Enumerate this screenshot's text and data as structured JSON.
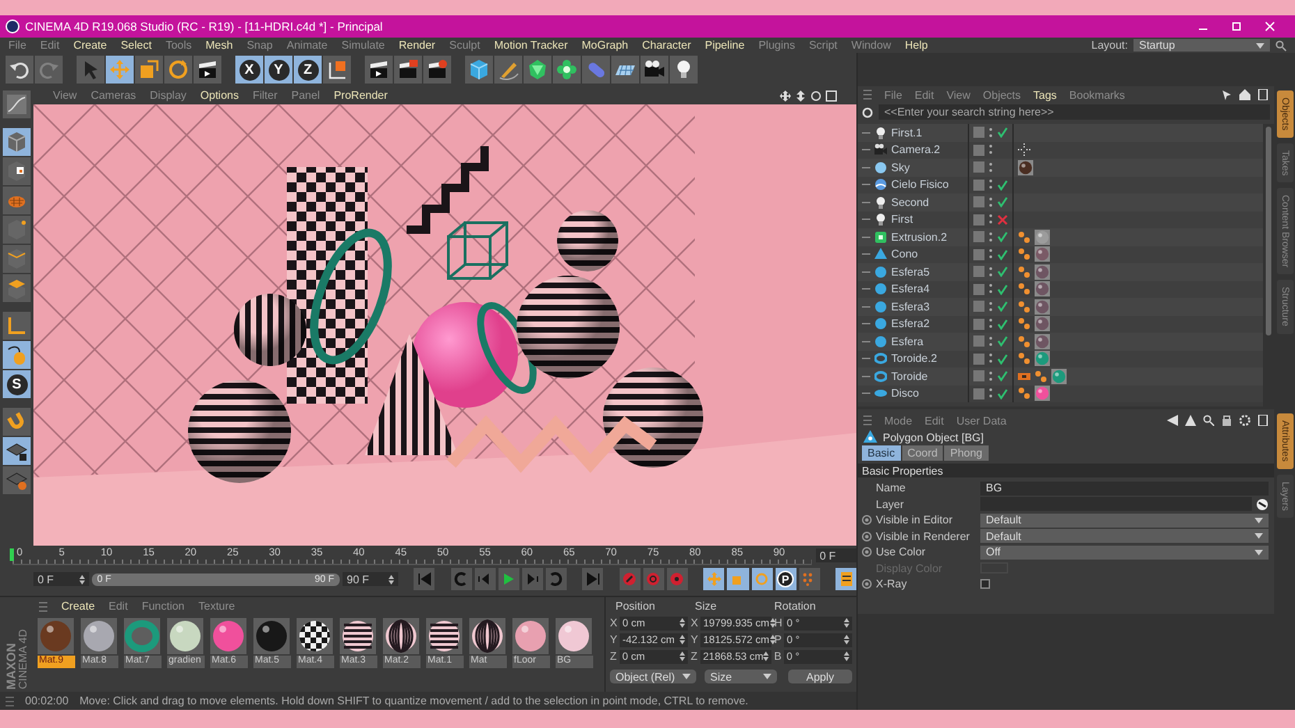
{
  "window": {
    "title": "CINEMA 4D R19.068 Studio (RC - R19) - [11-HDRI.c4d *] - Principal"
  },
  "menu": [
    {
      "label": "File",
      "highlighted": false
    },
    {
      "label": "Edit",
      "highlighted": false
    },
    {
      "label": "Create",
      "highlighted": true
    },
    {
      "label": "Select",
      "highlighted": true
    },
    {
      "label": "Tools",
      "highlighted": false
    },
    {
      "label": "Mesh",
      "highlighted": true
    },
    {
      "label": "Snap",
      "highlighted": false
    },
    {
      "label": "Animate",
      "highlighted": false
    },
    {
      "label": "Simulate",
      "highlighted": false
    },
    {
      "label": "Render",
      "highlighted": true
    },
    {
      "label": "Sculpt",
      "highlighted": false
    },
    {
      "label": "Motion Tracker",
      "highlighted": true
    },
    {
      "label": "MoGraph",
      "highlighted": true
    },
    {
      "label": "Character",
      "highlighted": true
    },
    {
      "label": "Pipeline",
      "highlighted": true
    },
    {
      "label": "Plugins",
      "highlighted": false
    },
    {
      "label": "Script",
      "highlighted": false
    },
    {
      "label": "Window",
      "highlighted": false
    },
    {
      "label": "Help",
      "highlighted": true
    }
  ],
  "layout": {
    "label": "Layout:",
    "value": "Startup"
  },
  "toolbar": [
    {
      "selected": false,
      "disabled": false
    },
    {
      "selected": false,
      "disabled": true
    },
    {
      "selected": false,
      "disabled": false
    },
    {
      "selected": true,
      "disabled": false
    },
    {
      "selected": false,
      "disabled": false
    },
    {
      "selected": false,
      "disabled": false
    },
    {
      "selected": false,
      "disabled": false
    },
    {
      "label": "X",
      "selected": true,
      "disabled": false
    },
    {
      "label": "Y",
      "selected": true,
      "disabled": false
    },
    {
      "label": "Z",
      "selected": true,
      "disabled": false
    },
    {
      "selected": false,
      "disabled": false
    },
    {
      "selected": false,
      "disabled": false
    },
    {
      "selected": false,
      "disabled": false
    },
    {
      "selected": false,
      "disabled": false
    },
    {
      "selected": false,
      "disabled": false
    },
    {
      "selected": false,
      "disabled": false
    },
    {
      "selected": false,
      "disabled": false
    },
    {
      "selected": false,
      "disabled": false
    },
    {
      "selected": false,
      "disabled": false
    },
    {
      "selected": false,
      "disabled": false
    },
    {
      "selected": false,
      "disabled": false
    },
    {
      "selected": false,
      "disabled": false
    }
  ],
  "left_tools": [
    {
      "selected": false
    },
    {
      "selected": true
    },
    {
      "selected": false
    },
    {
      "selected": false
    },
    {
      "selected": false
    },
    {
      "selected": false
    },
    {
      "selected": false
    },
    {
      "selected": false
    },
    {
      "selected": true
    },
    {
      "label": "S",
      "selected": true
    },
    {
      "selected": false
    },
    {
      "selected": true
    },
    {
      "selected": false
    }
  ],
  "viewport": {
    "menu": [
      {
        "label": "View",
        "highlighted": false
      },
      {
        "label": "Cameras",
        "highlighted": false
      },
      {
        "label": "Display",
        "highlighted": false
      },
      {
        "label": "Options",
        "highlighted": true
      },
      {
        "label": "Filter",
        "highlighted": false
      },
      {
        "label": "Panel",
        "highlighted": false
      },
      {
        "label": "ProRender",
        "highlighted": true
      }
    ]
  },
  "objects": {
    "menu": [
      {
        "label": "File",
        "highlighted": false
      },
      {
        "label": "Edit",
        "highlighted": false
      },
      {
        "label": "View",
        "highlighted": false
      },
      {
        "label": "Objects",
        "highlighted": false
      },
      {
        "label": "Tags",
        "highlighted": true
      },
      {
        "label": "Bookmarks",
        "highlighted": false
      }
    ],
    "search": {
      "placeholder": "<<Enter your search string here>>"
    },
    "items": [
      {
        "name": "First.1",
        "kind": "light",
        "enabled": true
      },
      {
        "name": "Camera.2",
        "kind": "camera",
        "tags": [
          {
            "kind": "target"
          }
        ]
      },
      {
        "name": "Sky",
        "kind": "sky",
        "tags": [
          {
            "kind": "material",
            "color": "#4a2e22"
          }
        ]
      },
      {
        "name": "Cielo Fisico",
        "kind": "physical-sky",
        "enabled": true
      },
      {
        "name": "Second",
        "kind": "light",
        "enabled": true
      },
      {
        "name": "First",
        "kind": "light",
        "enabled": false
      },
      {
        "name": "Extrusion.2",
        "kind": "extrude",
        "enabled": true,
        "tags": [
          {
            "kind": "phong"
          },
          {
            "kind": "material",
            "color": "#9c9c9c"
          }
        ]
      },
      {
        "name": "Cono",
        "kind": "cone",
        "enabled": true,
        "tags": [
          {
            "kind": "phong"
          },
          {
            "kind": "material",
            "color": "#7a5a66"
          }
        ]
      },
      {
        "name": "Esfera5",
        "kind": "sphere",
        "enabled": true,
        "tags": [
          {
            "kind": "phong"
          },
          {
            "kind": "material",
            "color": "#6e5562"
          }
        ]
      },
      {
        "name": "Esfera4",
        "kind": "sphere",
        "enabled": true,
        "tags": [
          {
            "kind": "phong"
          },
          {
            "kind": "material",
            "color": "#6e5562"
          }
        ]
      },
      {
        "name": "Esfera3",
        "kind": "sphere",
        "enabled": true,
        "tags": [
          {
            "kind": "phong"
          },
          {
            "kind": "material",
            "color": "#6e5562"
          }
        ]
      },
      {
        "name": "Esfera2",
        "kind": "sphere",
        "enabled": true,
        "tags": [
          {
            "kind": "phong"
          },
          {
            "kind": "material",
            "color": "#6e5562"
          }
        ]
      },
      {
        "name": "Esfera",
        "kind": "sphere",
        "enabled": true,
        "tags": [
          {
            "kind": "phong"
          },
          {
            "kind": "material",
            "color": "#6e5562"
          }
        ]
      },
      {
        "name": "Toroide.2",
        "kind": "torus",
        "enabled": true,
        "tags": [
          {
            "kind": "phong"
          },
          {
            "kind": "material",
            "color": "#1c9a7c"
          }
        ]
      },
      {
        "name": "Toroide",
        "kind": "torus",
        "enabled": true,
        "tags": [
          {
            "kind": "restrict"
          },
          {
            "kind": "phong"
          },
          {
            "kind": "material",
            "color": "#1c9a7c"
          }
        ]
      },
      {
        "name": "Disco",
        "kind": "disc",
        "enabled": true,
        "tags": [
          {
            "kind": "phong"
          },
          {
            "kind": "material",
            "color": "#f0509c"
          }
        ]
      }
    ]
  },
  "side_tabs_top": [
    {
      "label": "Objects",
      "selected": true
    },
    {
      "label": "Takes",
      "selected": false
    },
    {
      "label": "Content Browser",
      "selected": false
    },
    {
      "label": "Structure",
      "selected": false
    }
  ],
  "attributes": {
    "menu": [
      {
        "label": "Mode",
        "highlighted": false
      },
      {
        "label": "Edit",
        "highlighted": false
      },
      {
        "label": "User Data",
        "highlighted": false
      }
    ],
    "title": "Polygon Object [BG]",
    "tabs": [
      {
        "label": "Basic",
        "selected": true
      },
      {
        "label": "Coord",
        "selected": false
      },
      {
        "label": "Phong",
        "selected": false
      }
    ],
    "section": "Basic Properties",
    "fields": [
      {
        "kind": "text",
        "label": "Name",
        "value": "BG"
      },
      {
        "kind": "link",
        "label": "Layer"
      },
      {
        "kind": "dropdown",
        "label": "Visible in Editor",
        "value": "Default"
      },
      {
        "kind": "dropdown",
        "label": "Visible in Renderer",
        "value": "Default"
      },
      {
        "kind": "dropdown",
        "label": "Use Color",
        "value": "Off"
      },
      {
        "kind": "color",
        "label": "Display Color",
        "disabled": true
      },
      {
        "kind": "checkbox",
        "label": "X-Ray",
        "checked": false
      }
    ]
  },
  "side_tabs_bottom": [
    {
      "label": "Attributes",
      "selected": true
    },
    {
      "label": "Layers",
      "selected": false
    }
  ],
  "timeline": {
    "ticks": [
      "0",
      "5",
      "10",
      "15",
      "20",
      "25",
      "30",
      "35",
      "40",
      "45",
      "50",
      "55",
      "60",
      "65",
      "70",
      "75",
      "80",
      "85",
      "90"
    ],
    "current_frame": "0 F",
    "start": "0 F",
    "range": {
      "start": "0 F",
      "end": "90 F",
      "level": 1
    },
    "end": "90 F",
    "param_label": "P"
  },
  "materials": {
    "menu": [
      {
        "label": "Create",
        "highlighted": true
      },
      {
        "label": "Edit",
        "highlighted": false
      },
      {
        "label": "Function",
        "highlighted": false
      },
      {
        "label": "Texture",
        "highlighted": false
      }
    ],
    "items": [
      {
        "name": "Mat.9",
        "kind": "sphere",
        "color": "#6a3a20",
        "selected": true
      },
      {
        "name": "Mat.8",
        "kind": "sphere",
        "color": "#a8a8b0",
        "selected": false
      },
      {
        "name": "Mat.7",
        "kind": "ring",
        "color": "#1c9a7c",
        "selected": false
      },
      {
        "name": "gradien",
        "kind": "sphere",
        "color": "#c8d8c0",
        "selected": false
      },
      {
        "name": "Mat.6",
        "kind": "sphere",
        "color": "#f0509c",
        "selected": false
      },
      {
        "name": "Mat.5",
        "kind": "sphere",
        "color": "#181818",
        "selected": false
      },
      {
        "name": "Mat.4",
        "kind": "checker",
        "color": "#181818",
        "selected": false
      },
      {
        "name": "Mat.3",
        "kind": "stripes",
        "color": "#241a20",
        "selected": false
      },
      {
        "name": "Mat.2",
        "kind": "vstripes",
        "color": "#241a20",
        "selected": false
      },
      {
        "name": "Mat.1",
        "kind": "stripes",
        "color": "#241a20",
        "selected": false
      },
      {
        "name": "Mat",
        "kind": "vstripes",
        "color": "#241a20",
        "selected": false
      },
      {
        "name": "fLoor",
        "kind": "sphere",
        "color": "#e8a0b0",
        "selected": false
      },
      {
        "name": "BG",
        "kind": "sphere",
        "color": "#f0c8d4",
        "selected": false
      }
    ]
  },
  "coordinates": {
    "headers": [
      "Position",
      "Size",
      "Rotation"
    ],
    "rows": [
      {
        "cells": [
          {
            "axis": "X",
            "value": "0 cm"
          },
          {
            "axis": "X",
            "value": "19799.935 cm"
          },
          {
            "axis": "H",
            "value": "0 °"
          }
        ]
      },
      {
        "cells": [
          {
            "axis": "Y",
            "value": "-42.132 cm"
          },
          {
            "axis": "Y",
            "value": "18125.572 cm"
          },
          {
            "axis": "P",
            "value": "0 °"
          }
        ]
      },
      {
        "cells": [
          {
            "axis": "Z",
            "value": "0 cm"
          },
          {
            "axis": "Z",
            "value": "21868.53 cm"
          },
          {
            "axis": "B",
            "value": "0 °"
          }
        ]
      }
    ],
    "mode": "Object (Rel)",
    "size_mode": "Size",
    "apply": "Apply"
  },
  "logo": {
    "brand": "MAXON",
    "product": "CINEMA 4D"
  },
  "status_bar": {
    "time": "00:02:00",
    "message": "Move: Click and drag to move elements. Hold down SHIFT to quantize movement / add to the selection in point mode, CTRL to remove."
  }
}
